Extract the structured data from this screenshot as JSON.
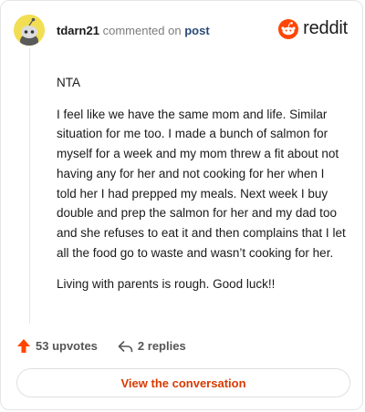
{
  "header": {
    "username": "tdarn21",
    "action_text": "commented on",
    "post_link": "post"
  },
  "brand": {
    "wordmark": "reddit",
    "color": "#ff4500"
  },
  "comment": {
    "paragraphs": [
      "NTA",
      "I feel like we have the same mom and life. Similar situation for me too. I made a bunch of salmon for myself for a week and my mom threw a fit about not having any for her and not cooking for her when I told her I had prepped my meals. Next week I buy double and prep the salmon for her and my dad too and she refuses to eat it and then complains that I let all the food go to waste and wasn’t cooking for her.",
      "Living with parents is rough. Good luck!!"
    ]
  },
  "actions": {
    "upvotes": "53 upvotes",
    "replies": "2 replies"
  },
  "cta": {
    "label": "View the conversation"
  },
  "colors": {
    "accent": "#d93a00",
    "avatar_bg": "#f2de53"
  },
  "icons": [
    "snoo-avatar-icon",
    "reddit-logo-icon",
    "upvote-arrow-icon",
    "reply-arrow-icon"
  ]
}
